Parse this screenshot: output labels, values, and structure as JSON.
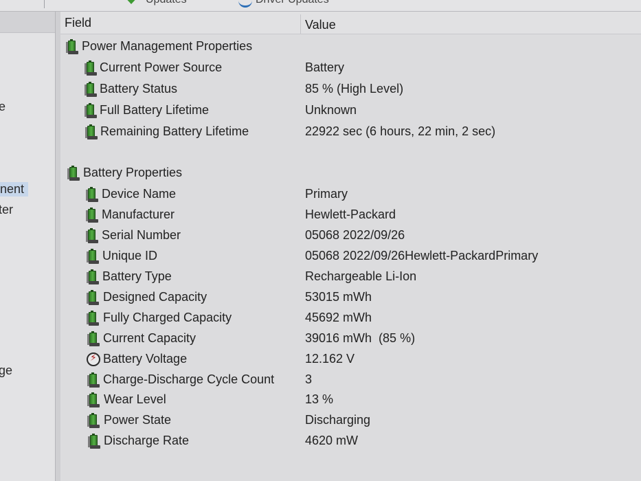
{
  "toolbar": {
    "fragment_1": "Updates",
    "fragment_2": "Driver Updates"
  },
  "left_pane": {
    "items": [
      {
        "label": "e",
        "selected": false
      },
      {
        "label": "nent",
        "selected": true
      },
      {
        "label": "ter",
        "selected": false
      },
      {
        "label": "ge",
        "selected": false
      }
    ]
  },
  "columns": {
    "field": "Field",
    "value": "Value"
  },
  "sections": [
    {
      "title": "Power Management Properties",
      "icon": "battery-icon",
      "rows": [
        {
          "field": "Current Power Source",
          "value": "Battery",
          "icon": "battery-icon"
        },
        {
          "field": "Battery Status",
          "value": "85 % (High Level)",
          "icon": "battery-icon"
        },
        {
          "field": "Full Battery Lifetime",
          "value": "Unknown",
          "icon": "battery-icon"
        },
        {
          "field": "Remaining Battery Lifetime",
          "value": "22922 sec (6 hours, 22 min, 2 sec)",
          "icon": "battery-icon"
        }
      ]
    },
    {
      "title": "Battery Properties",
      "icon": "battery-icon",
      "rows": [
        {
          "field": "Device Name",
          "value": "Primary",
          "icon": "battery-icon"
        },
        {
          "field": "Manufacturer",
          "value": "Hewlett-Packard",
          "icon": "battery-icon"
        },
        {
          "field": "Serial Number",
          "value": "05068 2022/09/26",
          "icon": "battery-icon"
        },
        {
          "field": "Unique ID",
          "value": "05068 2022/09/26Hewlett-PackardPrimary",
          "icon": "battery-icon"
        },
        {
          "field": "Battery Type",
          "value": "Rechargeable Li-Ion",
          "icon": "battery-icon"
        },
        {
          "field": "Designed Capacity",
          "value": "53015 mWh",
          "icon": "battery-icon"
        },
        {
          "field": "Fully Charged Capacity",
          "value": "45692 mWh",
          "icon": "battery-icon"
        },
        {
          "field": "Current Capacity",
          "value": "39016 mWh  (85 %)",
          "icon": "battery-icon"
        },
        {
          "field": "Battery Voltage",
          "value": "12.162 V",
          "icon": "voltage-icon"
        },
        {
          "field": "Charge-Discharge Cycle Count",
          "value": "3",
          "icon": "battery-icon"
        },
        {
          "field": "Wear Level",
          "value": "13 %",
          "icon": "battery-icon"
        },
        {
          "field": "Power State",
          "value": "Discharging",
          "icon": "battery-icon"
        },
        {
          "field": "Discharge Rate",
          "value": "4620 mW",
          "icon": "battery-icon"
        }
      ]
    }
  ],
  "colors": {
    "battery_green": "#3e9a33",
    "selection": "#c6d6ea",
    "bolt_red": "#b21f1f"
  }
}
